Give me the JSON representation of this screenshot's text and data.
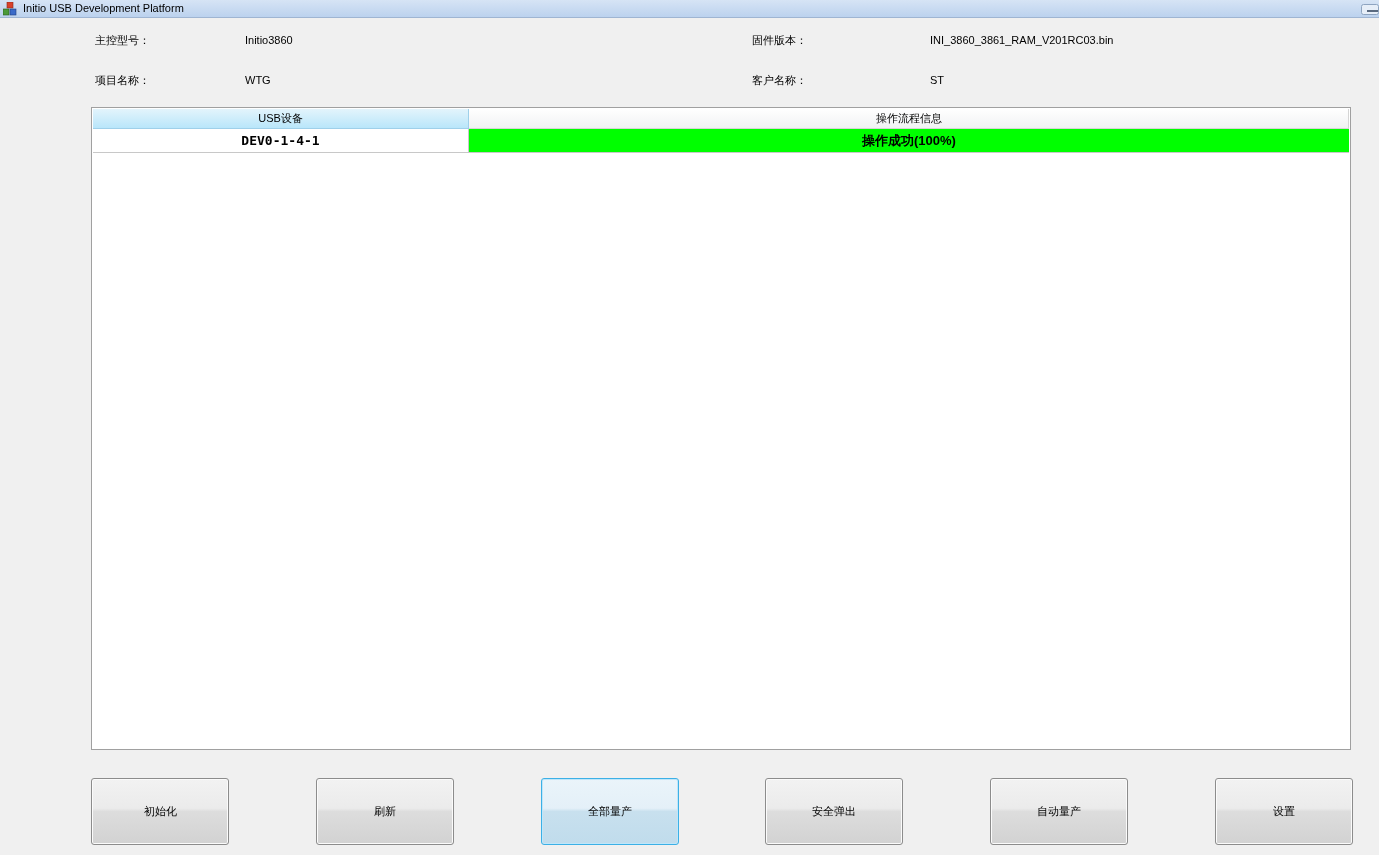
{
  "window": {
    "title": "Initio USB Development Platform"
  },
  "info": [
    {
      "label": "主控型号：",
      "value": "Initio3860"
    },
    {
      "label": "固件版本：",
      "value": "INI_3860_3861_RAM_V201RC03.bin"
    },
    {
      "label": "项目名称：",
      "value": "WTG"
    },
    {
      "label": "客户名称：",
      "value": "ST"
    }
  ],
  "table": {
    "columns": [
      {
        "label": "USB设备",
        "selected": true
      },
      {
        "label": "操作流程信息",
        "selected": false
      }
    ],
    "rows": [
      {
        "device": "DEV0-1-4-1",
        "status": "操作成功(100%)",
        "color": "#00ff00"
      }
    ]
  },
  "buttons": [
    {
      "label": "初始化",
      "focused": false
    },
    {
      "label": "刷新",
      "focused": false
    },
    {
      "label": "全部量产",
      "focused": true
    },
    {
      "label": "安全弹出",
      "focused": false
    },
    {
      "label": "自动量产",
      "focused": false
    },
    {
      "label": "设置",
      "focused": false
    }
  ]
}
